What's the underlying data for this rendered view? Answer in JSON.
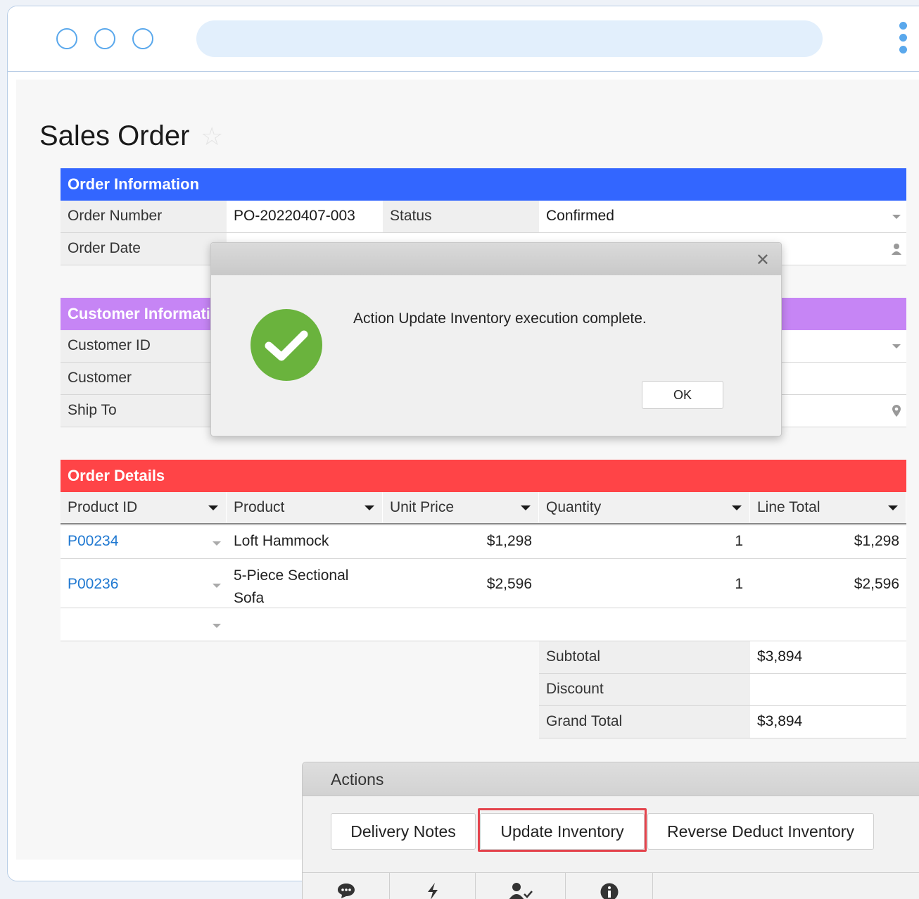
{
  "page": {
    "title": "Sales Order"
  },
  "order_information": {
    "header": "Order Information",
    "header_color": "#3366ff",
    "fields": {
      "order_number_label": "Order Number",
      "order_number_value": "PO-20220407-003",
      "status_label": "Status",
      "status_value": "Confirmed",
      "order_date_label": "Order Date"
    }
  },
  "customer_information": {
    "header": "Customer Informati",
    "header_color": "#c685f5",
    "fields": {
      "customer_id_label": "Customer ID",
      "customer_label": "Customer",
      "ship_to_label": "Ship To"
    }
  },
  "order_details": {
    "header": "Order Details",
    "header_color": "#ff4447",
    "columns": [
      "Product ID",
      "Product",
      "Unit Price",
      "Quantity",
      "Line Total"
    ],
    "rows": [
      {
        "product_id": "P00234",
        "product": "Loft Hammock",
        "unit_price": "$1,298",
        "quantity": "1",
        "line_total": "$1,298"
      },
      {
        "product_id": "P00236",
        "product_line1": "5-Piece Sectional",
        "product_line2": "Sofa",
        "unit_price": "$2,596",
        "quantity": "1",
        "line_total": "$2,596"
      }
    ],
    "totals": {
      "subtotal_label": "Subtotal",
      "subtotal_value": "$3,894",
      "discount_label": "Discount",
      "discount_value": "",
      "grand_total_label": "Grand Total",
      "grand_total_value": "$3,894"
    }
  },
  "dialog": {
    "message": "Action Update Inventory execution complete.",
    "ok_label": "OK",
    "icon": "check-icon",
    "icon_color": "#6ab33d"
  },
  "actions": {
    "title": "Actions",
    "buttons": [
      "Delivery Notes",
      "Update Inventory",
      "Reverse Deduct Inventory"
    ],
    "highlighted": "Update Inventory",
    "highlight_color": "#e4444d",
    "toolbar_icons": [
      "comment-icon",
      "lightning-icon",
      "user-check-icon",
      "info-icon"
    ]
  }
}
